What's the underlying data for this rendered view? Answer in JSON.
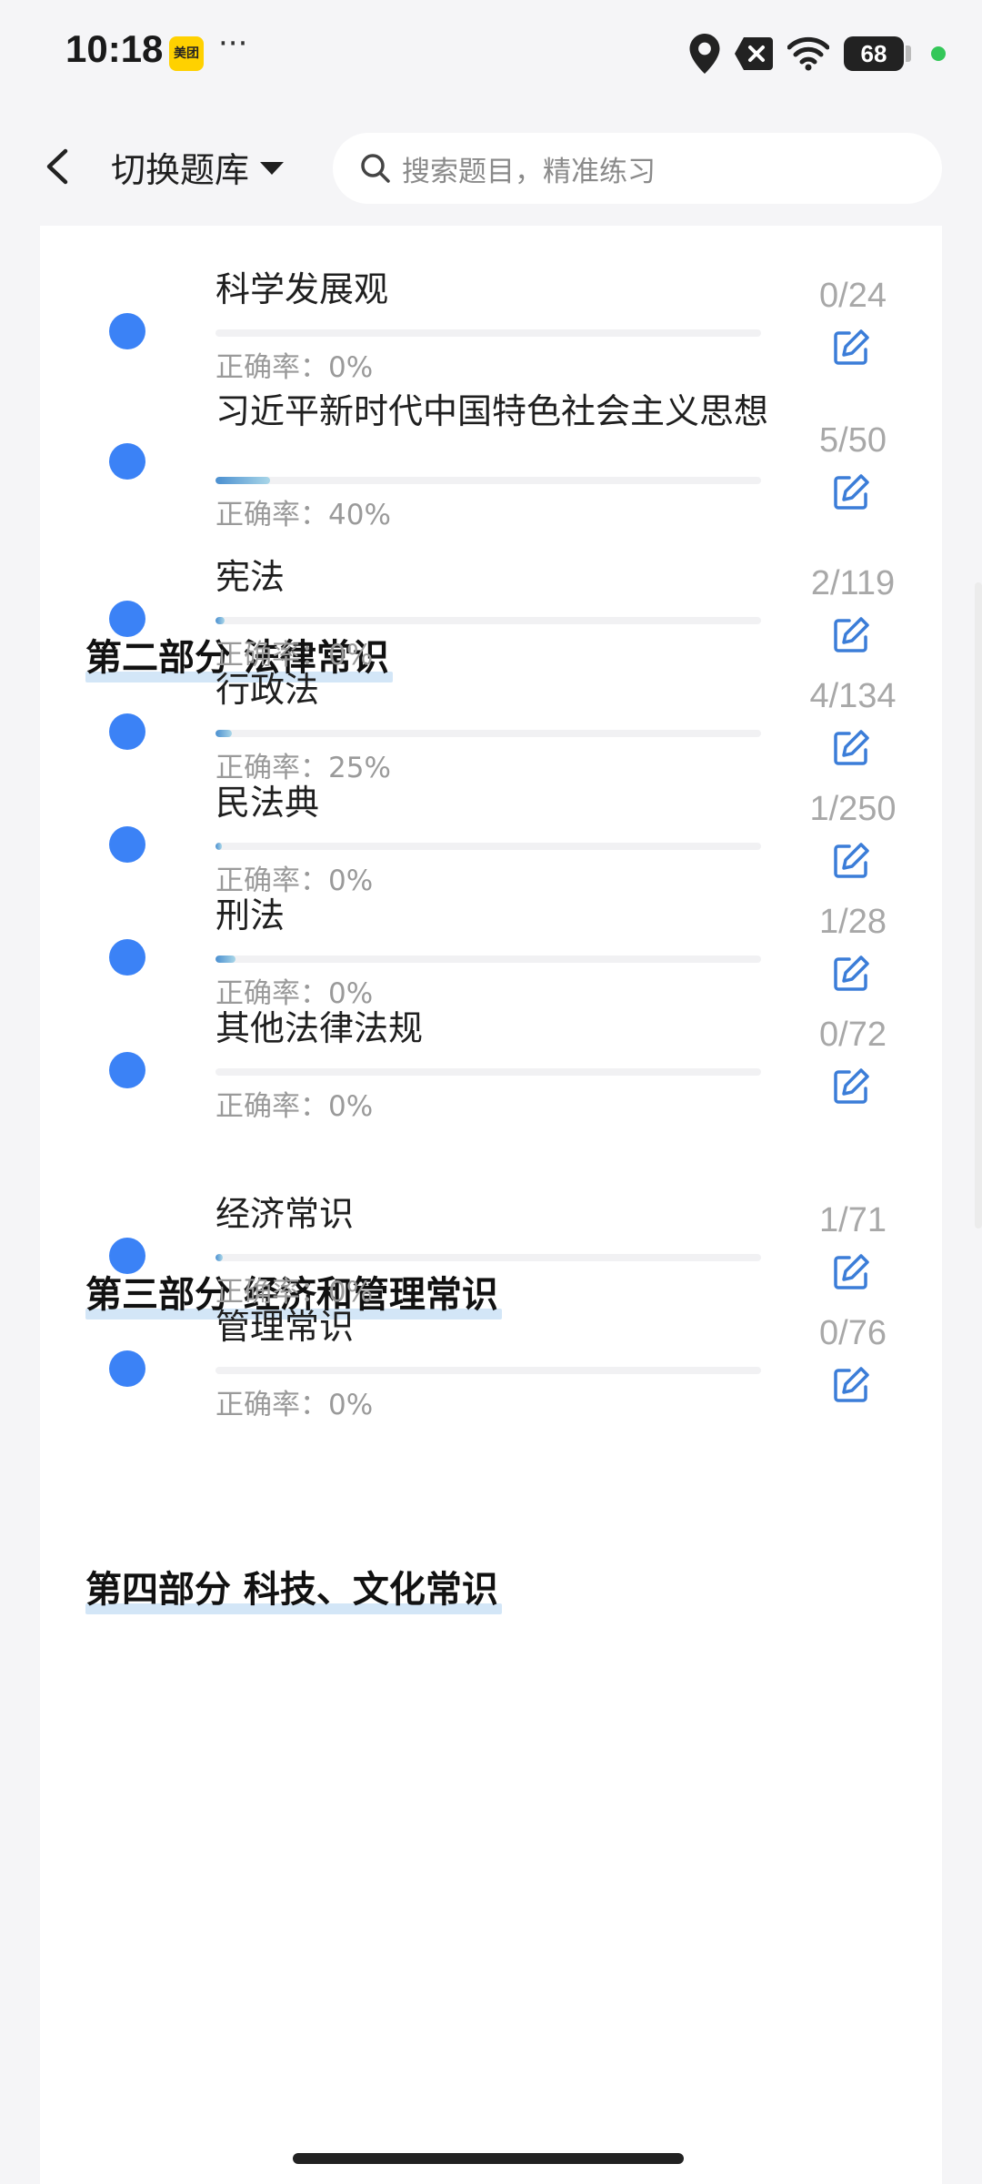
{
  "status_bar": {
    "time": "10:18",
    "app_badge": "美团",
    "more": "···",
    "battery": "68"
  },
  "header": {
    "switch_label": "切换题库",
    "search_placeholder": "搜索题目，精准练习"
  },
  "accent_color": "#3b82f6",
  "sections": [
    {
      "title": "",
      "items": [
        {
          "title": "科学发展观",
          "count": "0/24",
          "accuracy": "正确率：0%",
          "progress": 0.0
        },
        {
          "title": "习近平新时代中国特色社会主义思想",
          "count": "5/50",
          "accuracy": "正确率：40%",
          "progress": 0.1
        }
      ]
    },
    {
      "title": "第二部分  法律常识",
      "items": [
        {
          "title": "宪法",
          "count": "2/119",
          "accuracy": "正确率：0%",
          "progress": 0.017
        },
        {
          "title": "行政法",
          "count": "4/134",
          "accuracy": "正确率：25%",
          "progress": 0.03
        },
        {
          "title": "民法典",
          "count": "1/250",
          "accuracy": "正确率：0%",
          "progress": 0.004
        },
        {
          "title": "刑法",
          "count": "1/28",
          "accuracy": "正确率：0%",
          "progress": 0.036
        },
        {
          "title": "其他法律法规",
          "count": "0/72",
          "accuracy": "正确率：0%",
          "progress": 0.0
        }
      ]
    },
    {
      "title": "第三部分  经济和管理常识",
      "items": [
        {
          "title": "经济常识",
          "count": "1/71",
          "accuracy": "正确率：0%",
          "progress": 0.014
        },
        {
          "title": "管理常识",
          "count": "0/76",
          "accuracy": "正确率：0%",
          "progress": 0.0
        }
      ]
    },
    {
      "title": "第四部分  科技、文化常识",
      "items": []
    }
  ]
}
